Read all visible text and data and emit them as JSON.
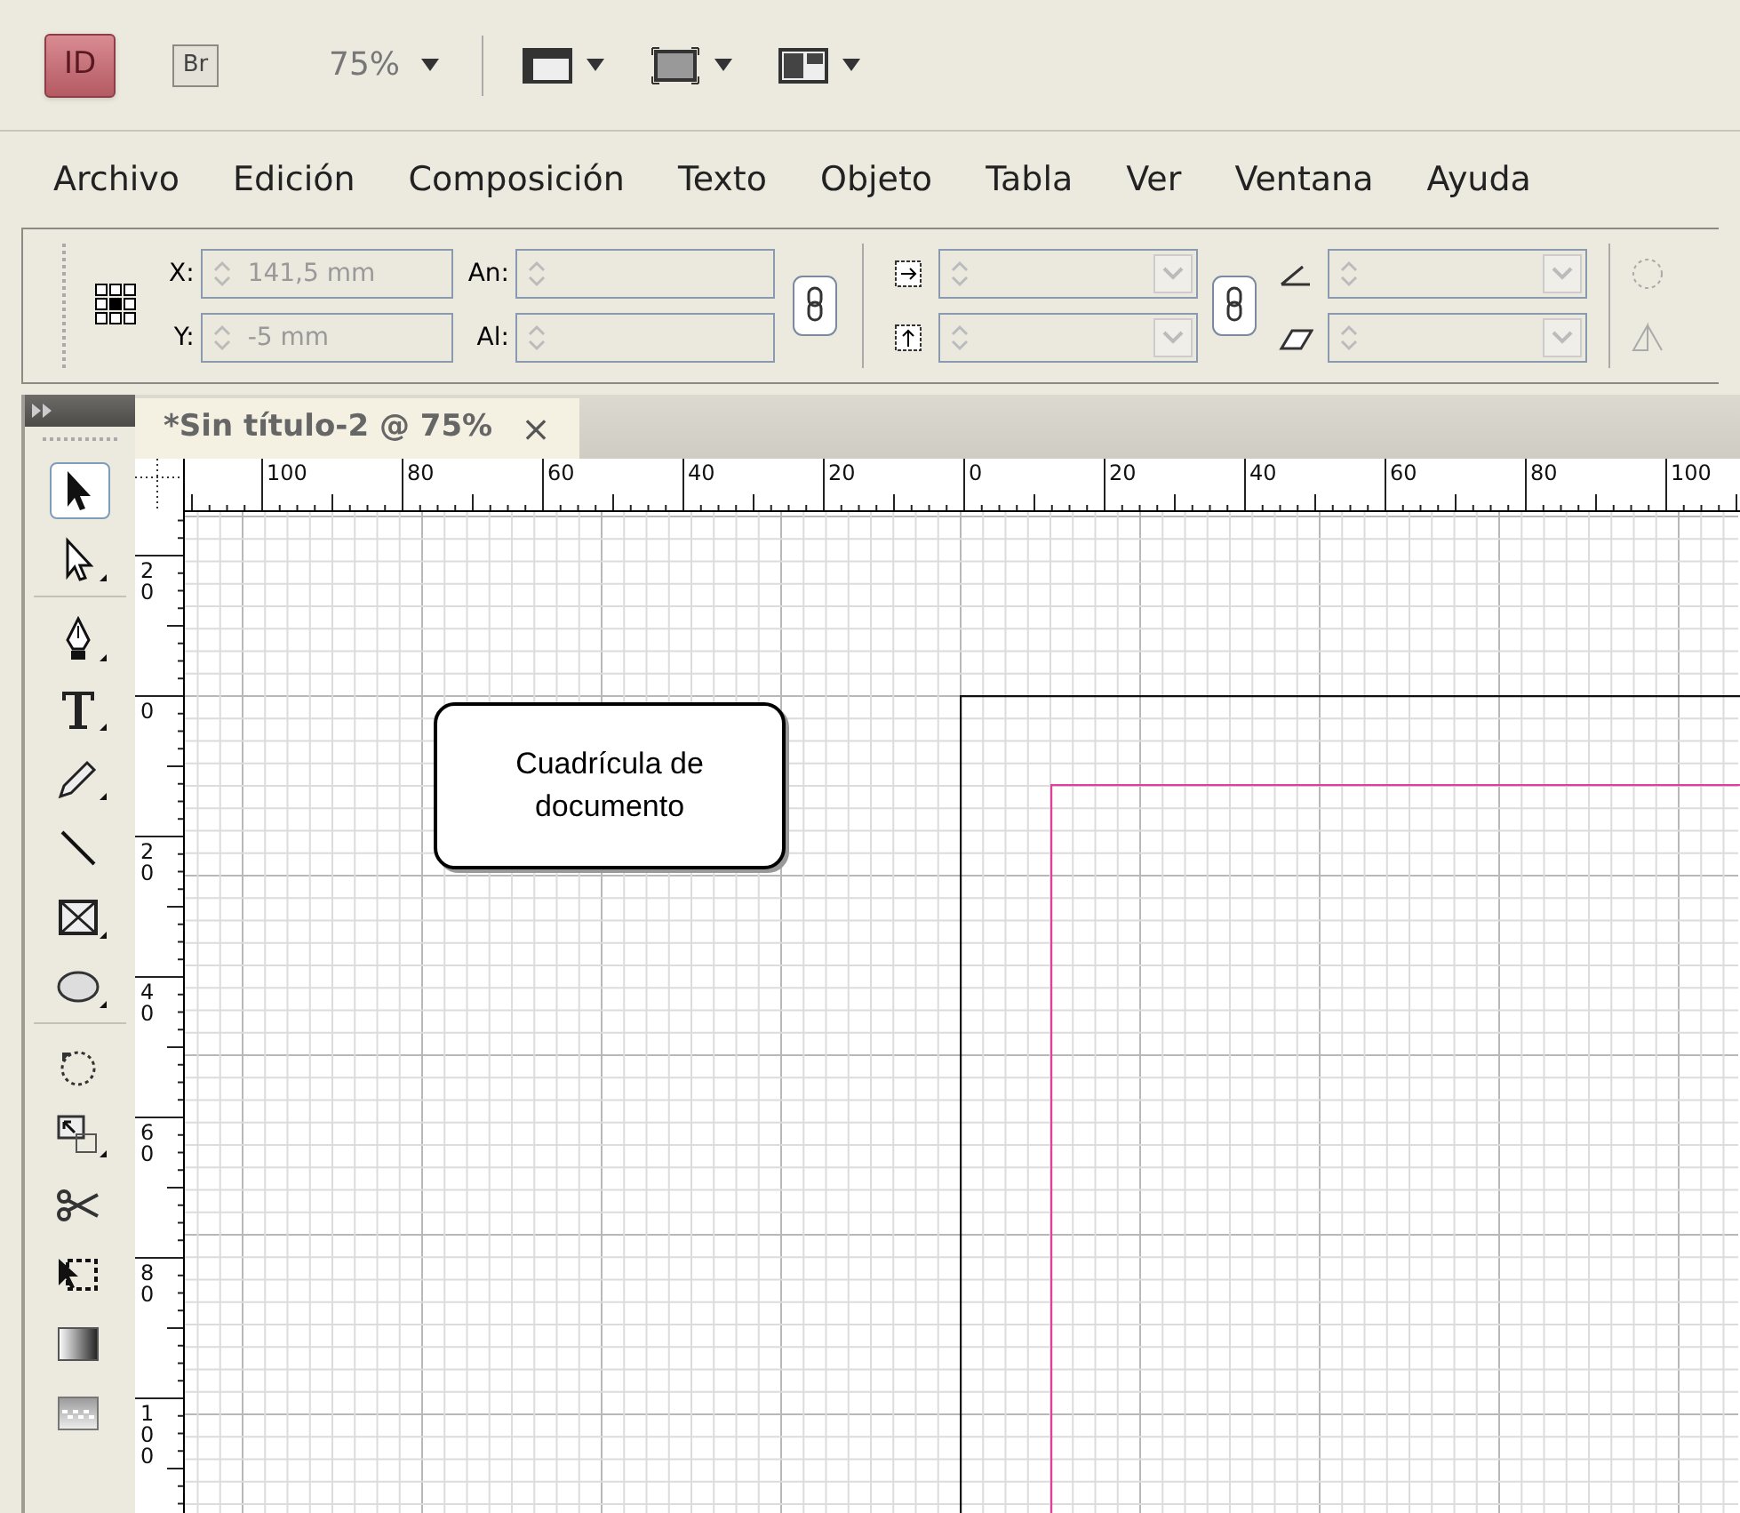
{
  "app_bar": {
    "logo": "ID",
    "bridge": "Br",
    "zoom": "75%"
  },
  "menu": [
    "Archivo",
    "Edición",
    "Composición",
    "Texto",
    "Objeto",
    "Tabla",
    "Ver",
    "Ventana",
    "Ayuda"
  ],
  "control_panel": {
    "x_label": "X:",
    "x_value": "141,5 mm",
    "y_label": "Y:",
    "y_value": "-5 mm",
    "w_label": "An:",
    "h_label": "Al:"
  },
  "document_tab": {
    "title": "*Sin título-2 @ 75%",
    "close": "×",
    "selected": true
  },
  "tool_groups": [
    [
      {
        "kind": "selection",
        "selected": true
      },
      {
        "kind": "direct-selection",
        "selected": false
      }
    ],
    [
      {
        "kind": "pen",
        "selected": false
      },
      {
        "kind": "type",
        "selected": false
      },
      {
        "kind": "pencil",
        "selected": false
      },
      {
        "kind": "line",
        "selected": false
      },
      {
        "kind": "frame",
        "selected": false
      },
      {
        "kind": "ellipse",
        "selected": false
      }
    ],
    [
      {
        "kind": "rotate",
        "selected": false
      },
      {
        "kind": "scale",
        "selected": false
      },
      {
        "kind": "scissors",
        "selected": false
      },
      {
        "kind": "free-transform",
        "selected": false
      },
      {
        "kind": "gradient",
        "selected": false
      },
      {
        "kind": "feather",
        "selected": false
      }
    ]
  ],
  "horizontal_ruler": [
    "100",
    "80",
    "60",
    "40",
    "20",
    "0",
    "20",
    "40",
    "60",
    "80",
    "100"
  ],
  "vertical_ruler": [
    "20",
    "0",
    "20",
    "40",
    "60",
    "80",
    "100"
  ],
  "callout": "Cuadrícula de documento"
}
